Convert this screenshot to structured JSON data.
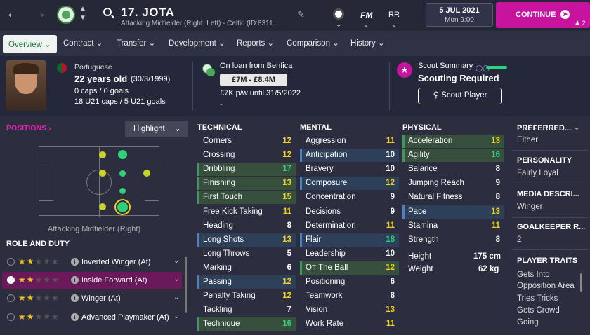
{
  "header": {
    "player_name": "17. JOTA",
    "player_sub": "Attacking Midfielder (Right, Left) - Celtic (ID:8311...",
    "fm_label": "FM",
    "rr_label": "RR",
    "date": "5 JUL 2021",
    "time": "Mon 9:00",
    "continue_label": "CONTINUE",
    "inbox_count": "2"
  },
  "tabs": [
    {
      "label": "Overview"
    },
    {
      "label": "Contract"
    },
    {
      "label": "Transfer"
    },
    {
      "label": "Development"
    },
    {
      "label": "Reports"
    },
    {
      "label": "Comparison"
    },
    {
      "label": "History"
    }
  ],
  "info": {
    "nationality": "Portuguese",
    "age": "22 years old",
    "dob": "(30/3/1999)",
    "caps": "0 caps / 0 goals",
    "u21": "18 U21 caps / 5 U21 goals",
    "loan": "On loan from Benfica",
    "value": "£7M - £8.4M",
    "wage": "£7K p/w until 31/5/2022",
    "dash": "-",
    "scout_title": "Scout Summary",
    "scout_status": "Scouting Required",
    "scout_button": "Scout Player"
  },
  "positions": {
    "label": "POSITIONS",
    "highlight": "Highlight",
    "caption": "Attacking Midfielder (Right)"
  },
  "role": {
    "heading": "ROLE AND DUTY",
    "rows": [
      {
        "name": "Inverted Winger (At)",
        "stars": 2
      },
      {
        "name": "Inside Forward (At)",
        "stars": 2
      },
      {
        "name": "Winger (At)",
        "stars": 2
      },
      {
        "name": "Advanced Playmaker (At)",
        "stars": 2
      }
    ]
  },
  "technical": {
    "heading": "TECHNICAL",
    "rows": [
      {
        "name": "Corners",
        "value": "12",
        "style": "",
        "color": "y"
      },
      {
        "name": "Crossing",
        "value": "12",
        "style": "",
        "color": "y"
      },
      {
        "name": "Dribbling",
        "value": "17",
        "style": "hl",
        "color": "g"
      },
      {
        "name": "Finishing",
        "value": "13",
        "style": "hl",
        "color": "y"
      },
      {
        "name": "First Touch",
        "value": "15",
        "style": "hl",
        "color": "y"
      },
      {
        "name": "Free Kick Taking",
        "value": "11",
        "style": "",
        "color": "y"
      },
      {
        "name": "Heading",
        "value": "8",
        "style": "",
        "color": "w"
      },
      {
        "name": "Long Shots",
        "value": "13",
        "style": "blue",
        "color": "y"
      },
      {
        "name": "Long Throws",
        "value": "5",
        "style": "",
        "color": "w"
      },
      {
        "name": "Marking",
        "value": "6",
        "style": "",
        "color": "w"
      },
      {
        "name": "Passing",
        "value": "12",
        "style": "blue",
        "color": "y"
      },
      {
        "name": "Penalty Taking",
        "value": "12",
        "style": "",
        "color": "y"
      },
      {
        "name": "Tackling",
        "value": "7",
        "style": "",
        "color": "w"
      },
      {
        "name": "Technique",
        "value": "16",
        "style": "hl",
        "color": "g"
      }
    ]
  },
  "mental": {
    "heading": "MENTAL",
    "rows": [
      {
        "name": "Aggression",
        "value": "11",
        "style": "",
        "color": "y"
      },
      {
        "name": "Anticipation",
        "value": "10",
        "style": "blue",
        "color": "w"
      },
      {
        "name": "Bravery",
        "value": "10",
        "style": "",
        "color": "w"
      },
      {
        "name": "Composure",
        "value": "12",
        "style": "blue",
        "color": "y"
      },
      {
        "name": "Concentration",
        "value": "9",
        "style": "",
        "color": "w"
      },
      {
        "name": "Decisions",
        "value": "9",
        "style": "",
        "color": "w"
      },
      {
        "name": "Determination",
        "value": "11",
        "style": "",
        "color": "y"
      },
      {
        "name": "Flair",
        "value": "18",
        "style": "blue",
        "color": "g"
      },
      {
        "name": "Leadership",
        "value": "10",
        "style": "",
        "color": "w"
      },
      {
        "name": "Off The Ball",
        "value": "12",
        "style": "hl",
        "color": "y"
      },
      {
        "name": "Positioning",
        "value": "6",
        "style": "",
        "color": "w"
      },
      {
        "name": "Teamwork",
        "value": "8",
        "style": "",
        "color": "w"
      },
      {
        "name": "Vision",
        "value": "13",
        "style": "",
        "color": "y"
      },
      {
        "name": "Work Rate",
        "value": "11",
        "style": "",
        "color": "y"
      }
    ]
  },
  "physical": {
    "heading": "PHYSICAL",
    "rows": [
      {
        "name": "Acceleration",
        "value": "13",
        "style": "hl",
        "color": "y"
      },
      {
        "name": "Agility",
        "value": "16",
        "style": "hl",
        "color": "g"
      },
      {
        "name": "Balance",
        "value": "8",
        "style": "",
        "color": "w"
      },
      {
        "name": "Jumping Reach",
        "value": "9",
        "style": "",
        "color": "w"
      },
      {
        "name": "Natural Fitness",
        "value": "8",
        "style": "",
        "color": "w"
      },
      {
        "name": "Pace",
        "value": "13",
        "style": "blue",
        "color": "y"
      },
      {
        "name": "Stamina",
        "value": "11",
        "style": "",
        "color": "y"
      },
      {
        "name": "Strength",
        "value": "8",
        "style": "",
        "color": "w"
      }
    ],
    "height_label": "Height",
    "height": "175 cm",
    "weight_label": "Weight",
    "weight": "62 kg"
  },
  "right": {
    "preferred_head": "PREFERRED...",
    "preferred_val": "Either",
    "personality_head": "PERSONALITY",
    "personality_val": "Fairly Loyal",
    "media_head": "MEDIA DESCRI...",
    "media_val": "Winger",
    "gk_head": "GOALKEEPER R...",
    "gk_val": "2",
    "traits_head": "PLAYER TRAITS",
    "traits": [
      "Gets Into",
      "Opposition Area",
      "Tries Tricks",
      "Gets Crowd",
      "Going"
    ]
  }
}
